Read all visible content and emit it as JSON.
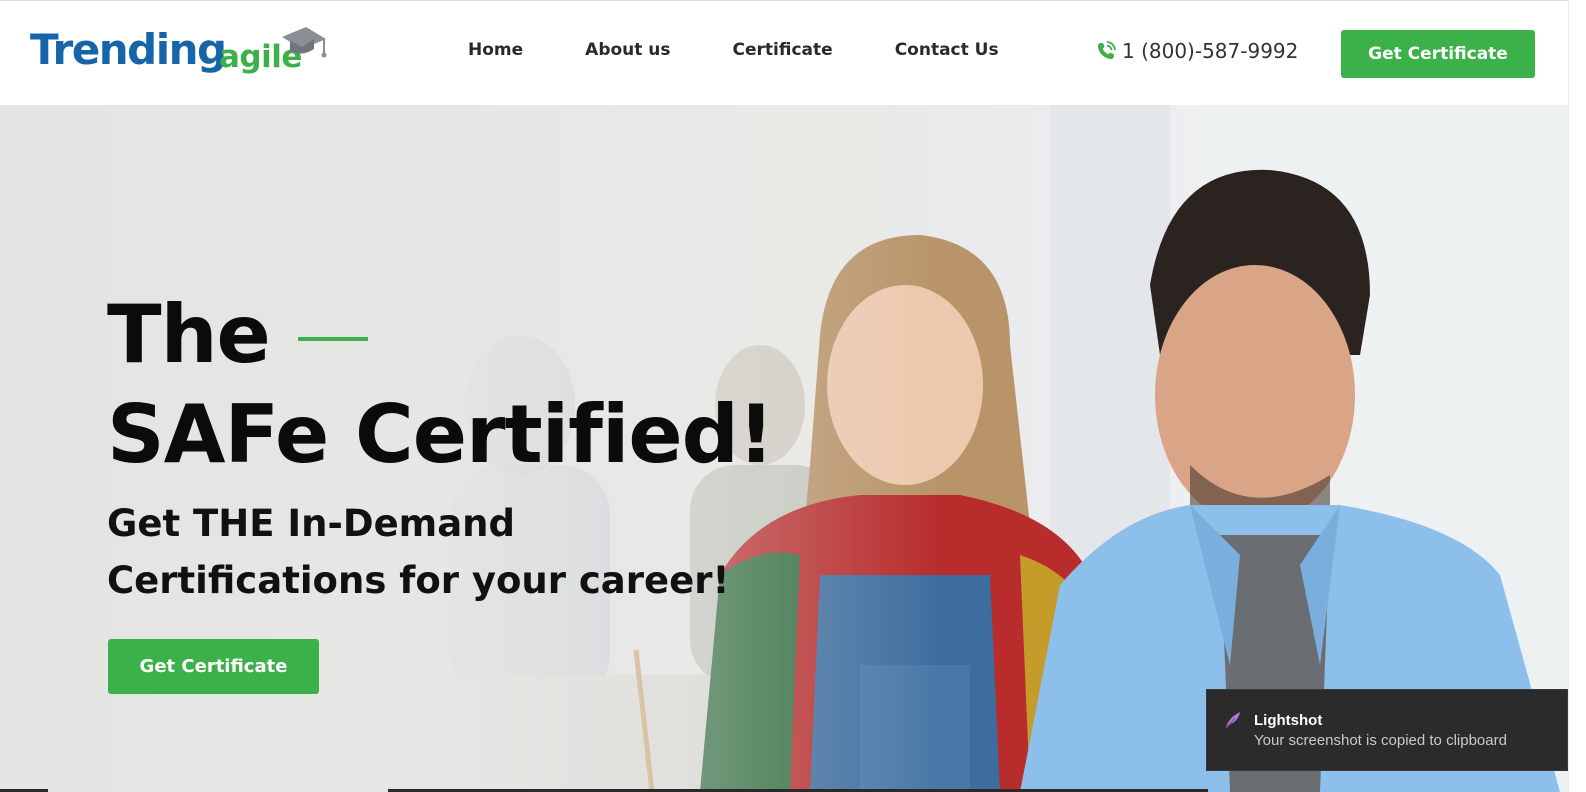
{
  "brand": {
    "logo_primary": "Trending",
    "logo_secondary": "agile",
    "colors": {
      "primary_blue": "#1565a8",
      "accent_green": "#3cb14a"
    }
  },
  "nav": {
    "items": [
      {
        "label": "Home"
      },
      {
        "label": "About us"
      },
      {
        "label": "Certificate"
      },
      {
        "label": "Contact Us"
      }
    ]
  },
  "header": {
    "phone_icon": "phone-icon",
    "phone": "1 (800)-587-9992",
    "cta_label": "Get Certificate"
  },
  "hero": {
    "title_line1": "The",
    "title_line2": "SAFe Certified!",
    "subtitle_line1": "Get THE In-Demand",
    "subtitle_line2": "Certifications for your career!",
    "cta_label": "Get Certificate"
  },
  "toast": {
    "icon": "feather-icon",
    "title": "Lightshot",
    "message": "Your screenshot is copied to clipboard"
  }
}
